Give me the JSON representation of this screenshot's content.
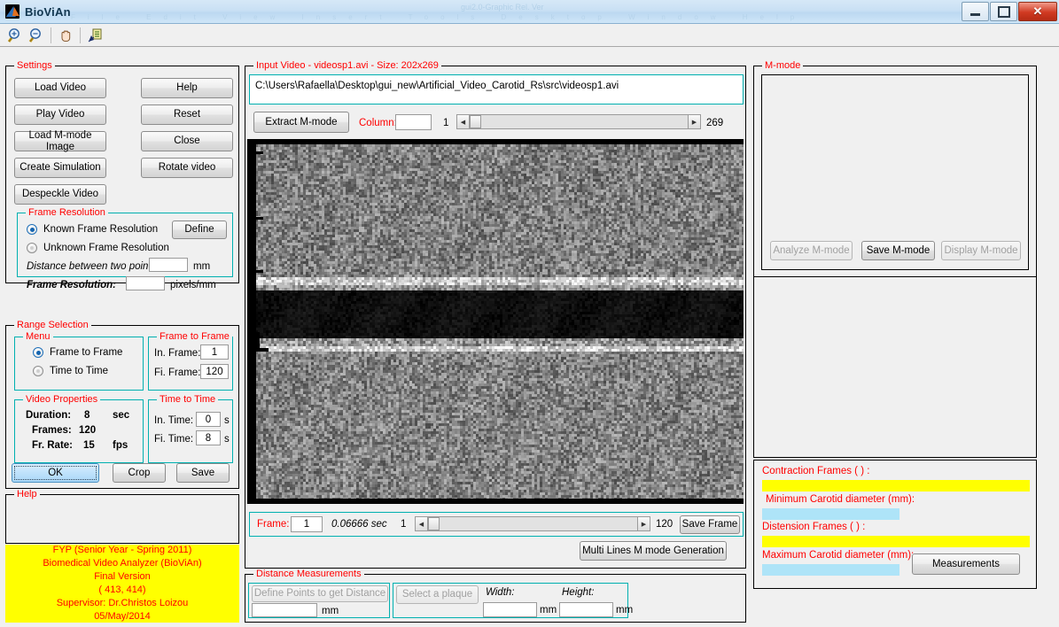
{
  "window": {
    "title": "BioViAn",
    "ghost_text": "gui2.0-Graphic Rel. Ver",
    "ghost_menu": "File  Edit  View  Insert  Tools  Desktop  Window  Help",
    "minimize_label": "Minimize",
    "maximize_label": "Maximize",
    "close_label": "✕"
  },
  "toolbar": {
    "items": [
      {
        "name": "zoom-in-icon",
        "label": "Zoom In"
      },
      {
        "name": "zoom-out-icon",
        "label": "Zoom Out"
      },
      {
        "name": "pan-icon",
        "label": "Pan"
      },
      {
        "name": "insert-legend-icon",
        "label": "Insert Legend"
      }
    ]
  },
  "settings": {
    "title": "Settings",
    "buttons_left": [
      "Load Video",
      "Play Video",
      "Load M-mode Image",
      "Create Simulation",
      "Despeckle Video"
    ],
    "buttons_right": [
      "Help",
      "Reset",
      "Close",
      "Rotate video"
    ]
  },
  "frame_resolution": {
    "title": "Frame Resolution",
    "known_label": "Known Frame Resolution",
    "unknown_label": "Unknown Frame Resolution",
    "known_selected": true,
    "define_button": "Define",
    "distance_label": "Distance between two points:",
    "distance_value": "",
    "distance_unit": "mm",
    "resolution_label": "Frame Resolution:",
    "resolution_value": "",
    "resolution_unit": "pixels/mm"
  },
  "range_selection": {
    "title": "Range Selection",
    "menu": {
      "title": "Menu",
      "option_frame": "Frame to Frame",
      "option_time": "Time to Time",
      "selected": "Frame to Frame"
    },
    "frame_to_frame": {
      "title": "Frame to Frame",
      "initial_label": "In. Frame:",
      "initial_value": "1",
      "final_label": "Fi. Frame:",
      "final_value": "120"
    },
    "video_properties": {
      "title": "Video Properties",
      "rows": [
        {
          "label": "Duration:",
          "value": "8",
          "unit": "sec"
        },
        {
          "label": "Frames:",
          "value": "120",
          "unit": ""
        },
        {
          "label": "Fr. Rate:",
          "value": "15",
          "unit": "fps"
        }
      ]
    },
    "time_to_time": {
      "title": "Time to Time",
      "initial_label": "In. Time:",
      "initial_value": "0",
      "initial_unit": "s",
      "final_label": "Fi. Time:",
      "final_value": "8",
      "final_unit": "s"
    },
    "ok_button": "OK",
    "crop_button": "Crop",
    "save_button": "Save"
  },
  "help": {
    "title": "Help",
    "content": ""
  },
  "credits": {
    "lines": [
      "FYP  (Senior Year - Spring 2011)",
      "Biomedical Video Analyzer (BioViAn)",
      "Final Version",
      "(      413,       414)",
      "Supervisor: Dr.Christos Loizou",
      "05/May/2014"
    ]
  },
  "input_video": {
    "title": "Input Video - videosp1.avi - Size: 202x269",
    "path": "C:\\Users\\Rafaella\\Desktop\\gui_new\\Artificial_Video_Carotid_Rs\\src\\videosp1.avi",
    "extract_button": "Extract M-mode",
    "column_label": "Column:",
    "column_value": "",
    "column_min": "1",
    "column_max": "269",
    "frame_label": "Frame:",
    "frame_value": "1",
    "frame_time": "0.06666  sec",
    "frame_min": "1",
    "frame_max": "120",
    "save_frame_button": "Save Frame",
    "multi_lines_button": "Multi Lines M mode Generation"
  },
  "distance_measurements": {
    "title": "Distance Measurements",
    "define_points_button": "Define Points to get Distance",
    "distance_value": "",
    "distance_unit": "mm",
    "select_plaque_button": "Select a plaque",
    "width_label": "Width:",
    "width_value": "",
    "width_unit": "mm",
    "height_label": "Height:",
    "height_value": "",
    "height_unit": "mm"
  },
  "mmode": {
    "title": "M-mode",
    "analyze_button": "Analyze M-mode",
    "save_button": "Save M-mode",
    "display_button": "Display M-mode"
  },
  "measurements": {
    "contraction_label": "Contraction Frames (            ) :",
    "contraction_value": "",
    "min_diameter_label": "Minimum Carotid diameter (mm):",
    "min_diameter_value": "",
    "distension_label": "Distension Frames (            ) :",
    "distension_value": "",
    "max_diameter_label": "Maximum Carotid diameter (mm):",
    "max_diameter_value": "",
    "measurements_button": "Measurements"
  },
  "colors": {
    "panel_title": "#ff0000",
    "panel_border_cyan": "#00b0b0",
    "highlight_yellow": "#ffff00",
    "highlight_cyan": "#aee4f8",
    "titlebar": "#c9e0f4"
  }
}
